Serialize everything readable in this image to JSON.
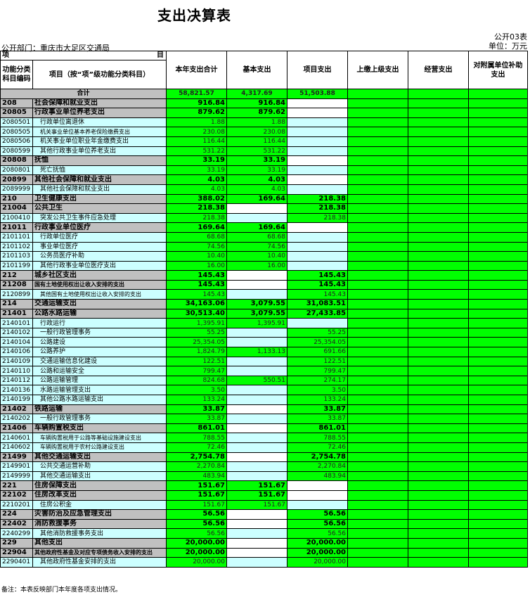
{
  "title": "支出决算表",
  "form_code": "公开03表",
  "unit": "单位：万元",
  "department": "公开部门：重庆市大足区交通局",
  "header": {
    "item_label": "项",
    "mu_label": "目",
    "code_label": "功能分类科目编码",
    "name_label": "项目（按“项”级功能分类科目）",
    "cols": [
      "本年支出合计",
      "基本支出",
      "项目支出",
      "上缴上级支出",
      "经营支出",
      "对附属单位补助支出"
    ]
  },
  "total": {
    "label": "合计",
    "values": [
      "58,821.57",
      "4,317.69",
      "51,503.88",
      "",
      "",
      ""
    ]
  },
  "rows": [
    {
      "code": "208",
      "name": "社会保障和就业支出",
      "level": 1,
      "v": [
        "916.84",
        "916.84",
        "",
        "",
        "",
        ""
      ]
    },
    {
      "code": "20805",
      "name": "行政事业单位养老支出",
      "level": 2,
      "v": [
        "879.62",
        "879.62",
        "",
        "",
        "",
        ""
      ]
    },
    {
      "code": "2080501",
      "name": "行政单位离退休",
      "level": 3,
      "v": [
        "1.88",
        "1.88",
        "",
        "",
        "",
        ""
      ]
    },
    {
      "code": "2080505",
      "name": "机关事业单位基本养老保险缴费支出",
      "level": 3,
      "v": [
        "230.08",
        "230.08",
        "",
        "",
        "",
        ""
      ]
    },
    {
      "code": "2080506",
      "name": "机关事业单位职业年金缴费支出",
      "level": 3,
      "v": [
        "116.44",
        "116.44",
        "",
        "",
        "",
        ""
      ]
    },
    {
      "code": "2080599",
      "name": "其他行政事业单位养老支出",
      "level": 3,
      "v": [
        "531.22",
        "531.22",
        "",
        "",
        "",
        ""
      ]
    },
    {
      "code": "20808",
      "name": "抚恤",
      "level": 2,
      "v": [
        "33.19",
        "33.19",
        "",
        "",
        "",
        ""
      ]
    },
    {
      "code": "2080801",
      "name": "死亡抚恤",
      "level": 3,
      "v": [
        "33.19",
        "33.19",
        "",
        "",
        "",
        ""
      ]
    },
    {
      "code": "20899",
      "name": "其他社会保障和就业支出",
      "level": 2,
      "v": [
        "4.03",
        "4.03",
        "",
        "",
        "",
        ""
      ]
    },
    {
      "code": "2089999",
      "name": "其他社会保障和就业支出",
      "level": 3,
      "v": [
        "4.03",
        "4.03",
        "",
        "",
        "",
        ""
      ]
    },
    {
      "code": "210",
      "name": "卫生健康支出",
      "level": 1,
      "v": [
        "388.02",
        "169.64",
        "218.38",
        "",
        "",
        ""
      ]
    },
    {
      "code": "21004",
      "name": "公共卫生",
      "level": 2,
      "v": [
        "218.38",
        "",
        "218.38",
        "",
        "",
        ""
      ]
    },
    {
      "code": "2100410",
      "name": "突发公共卫生事件应急处理",
      "level": 3,
      "v": [
        "218.38",
        "",
        "218.38",
        "",
        "",
        ""
      ]
    },
    {
      "code": "21011",
      "name": "行政事业单位医疗",
      "level": 2,
      "v": [
        "169.64",
        "169.64",
        "",
        "",
        "",
        ""
      ]
    },
    {
      "code": "2101101",
      "name": "行政单位医疗",
      "level": 3,
      "v": [
        "68.68",
        "68.68",
        "",
        "",
        "",
        ""
      ]
    },
    {
      "code": "2101102",
      "name": "事业单位医疗",
      "level": 3,
      "v": [
        "74.56",
        "74.56",
        "",
        "",
        "",
        ""
      ]
    },
    {
      "code": "2101103",
      "name": "公务员医疗补助",
      "level": 3,
      "v": [
        "10.40",
        "10.40",
        "",
        "",
        "",
        ""
      ]
    },
    {
      "code": "2101199",
      "name": "其他行政事业单位医疗支出",
      "level": 3,
      "v": [
        "16.00",
        "16.00",
        "",
        "",
        "",
        ""
      ]
    },
    {
      "code": "212",
      "name": "城乡社区支出",
      "level": 1,
      "v": [
        "145.43",
        "",
        "145.43",
        "",
        "",
        ""
      ]
    },
    {
      "code": "21208",
      "name": "国有土地使用权出让收入安排的支出",
      "level": 2,
      "v": [
        "145.43",
        "",
        "145.43",
        "",
        "",
        ""
      ]
    },
    {
      "code": "2120899",
      "name": "其他国有土地使用权出让收入安排的支出",
      "level": 3,
      "v": [
        "145.43",
        "",
        "145.43",
        "",
        "",
        ""
      ]
    },
    {
      "code": "214",
      "name": "交通运输支出",
      "level": 1,
      "v": [
        "34,163.06",
        "3,079.55",
        "31,083.51",
        "",
        "",
        ""
      ]
    },
    {
      "code": "21401",
      "name": "公路水路运输",
      "level": 2,
      "v": [
        "30,513.40",
        "3,079.55",
        "27,433.85",
        "",
        "",
        ""
      ]
    },
    {
      "code": "2140101",
      "name": "行政运行",
      "level": 3,
      "v": [
        "1,395.91",
        "1,395.91",
        "",
        "",
        "",
        ""
      ]
    },
    {
      "code": "2140102",
      "name": "一般行政管理事务",
      "level": 3,
      "v": [
        "55.25",
        "",
        "55.25",
        "",
        "",
        ""
      ]
    },
    {
      "code": "2140104",
      "name": "公路建设",
      "level": 3,
      "v": [
        "25,354.05",
        "",
        "25,354.05",
        "",
        "",
        ""
      ]
    },
    {
      "code": "2140106",
      "name": "公路养护",
      "level": 3,
      "v": [
        "1,824.79",
        "1,133.13",
        "691.66",
        "",
        "",
        ""
      ]
    },
    {
      "code": "2140109",
      "name": "交通运输信息化建设",
      "level": 3,
      "v": [
        "122.51",
        "",
        "122.51",
        "",
        "",
        ""
      ]
    },
    {
      "code": "2140110",
      "name": "公路和运输安全",
      "level": 3,
      "v": [
        "799.47",
        "",
        "799.47",
        "",
        "",
        ""
      ]
    },
    {
      "code": "2140112",
      "name": "公路运输管理",
      "level": 3,
      "v": [
        "824.68",
        "550.51",
        "274.17",
        "",
        "",
        ""
      ]
    },
    {
      "code": "2140136",
      "name": "水路运输管理支出",
      "level": 3,
      "v": [
        "3.50",
        "",
        "3.50",
        "",
        "",
        ""
      ]
    },
    {
      "code": "2140199",
      "name": "其他公路水路运输支出",
      "level": 3,
      "v": [
        "133.24",
        "",
        "133.24",
        "",
        "",
        ""
      ]
    },
    {
      "code": "21402",
      "name": "铁路运输",
      "level": 2,
      "v": [
        "33.87",
        "",
        "33.87",
        "",
        "",
        ""
      ]
    },
    {
      "code": "2140202",
      "name": "一般行政管理事务",
      "level": 3,
      "v": [
        "33.87",
        "",
        "33.87",
        "",
        "",
        ""
      ]
    },
    {
      "code": "21406",
      "name": "车辆购置税支出",
      "level": 2,
      "v": [
        "861.01",
        "",
        "861.01",
        "",
        "",
        ""
      ]
    },
    {
      "code": "2140601",
      "name": "车辆购置税用于公路等基础设施建设支出",
      "level": 3,
      "v": [
        "788.55",
        "",
        "788.55",
        "",
        "",
        ""
      ]
    },
    {
      "code": "2140602",
      "name": "车辆购置税用于农村公路建设支出",
      "level": 3,
      "v": [
        "72.46",
        "",
        "72.46",
        "",
        "",
        ""
      ]
    },
    {
      "code": "21499",
      "name": "其他交通运输支出",
      "level": 2,
      "v": [
        "2,754.78",
        "",
        "2,754.78",
        "",
        "",
        ""
      ]
    },
    {
      "code": "2149901",
      "name": "公共交通运营补助",
      "level": 3,
      "v": [
        "2,270.84",
        "",
        "2,270.84",
        "",
        "",
        ""
      ]
    },
    {
      "code": "2149999",
      "name": "其他交通运输支出",
      "level": 3,
      "v": [
        "483.94",
        "",
        "483.94",
        "",
        "",
        ""
      ]
    },
    {
      "code": "221",
      "name": "住房保障支出",
      "level": 1,
      "v": [
        "151.67",
        "151.67",
        "",
        "",
        "",
        ""
      ]
    },
    {
      "code": "22102",
      "name": "住房改革支出",
      "level": 2,
      "v": [
        "151.67",
        "151.67",
        "",
        "",
        "",
        ""
      ]
    },
    {
      "code": "2210201",
      "name": "住房公积金",
      "level": 3,
      "v": [
        "151.67",
        "151.67",
        "",
        "",
        "",
        ""
      ]
    },
    {
      "code": "224",
      "name": "灾害防治及应急管理支出",
      "level": 1,
      "v": [
        "56.56",
        "",
        "56.56",
        "",
        "",
        ""
      ]
    },
    {
      "code": "22402",
      "name": "消防救援事务",
      "level": 2,
      "v": [
        "56.56",
        "",
        "56.56",
        "",
        "",
        ""
      ]
    },
    {
      "code": "2240299",
      "name": "其他消防救援事务支出",
      "level": 3,
      "v": [
        "56.56",
        "",
        "56.56",
        "",
        "",
        ""
      ]
    },
    {
      "code": "229",
      "name": "其他支出",
      "level": 1,
      "v": [
        "20,000.00",
        "",
        "20,000.00",
        "",
        "",
        ""
      ]
    },
    {
      "code": "22904",
      "name": "其他政府性基金及对应专项债务收入安排的支出",
      "level": 2,
      "v": [
        "20,000.00",
        "",
        "20,000.00",
        "",
        "",
        ""
      ]
    },
    {
      "code": "2290401",
      "name": "其他政府性基金安排的支出",
      "level": 3,
      "v": [
        "20,000.00",
        "",
        "20,000.00",
        "",
        "",
        ""
      ]
    }
  ],
  "note": "备注：本表反映部门本年度各项支出情况。"
}
